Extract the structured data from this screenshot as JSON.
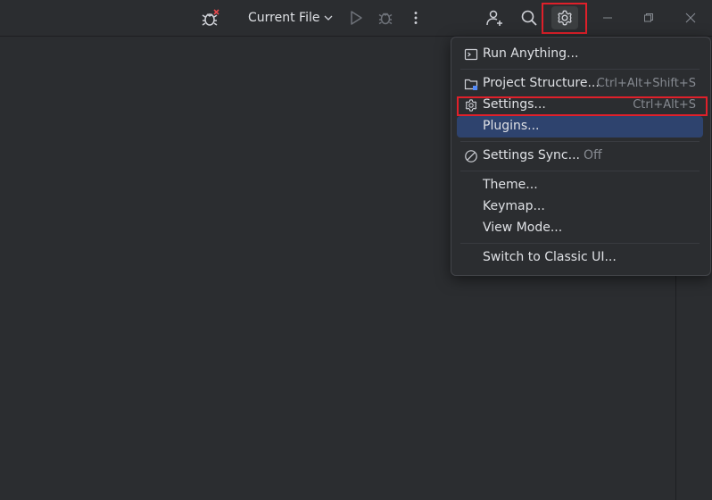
{
  "toolbar": {
    "run_config_label": "Current File",
    "icons": [
      "debug-bug-error-icon",
      "run-icon",
      "debug-icon",
      "more-vertical-icon",
      "add-user-icon",
      "search-icon",
      "settings-gear-icon",
      "minimize-icon",
      "restore-icon",
      "close-icon"
    ]
  },
  "menu": {
    "run_anything": "Run Anything...",
    "project_structure": "Project Structure...",
    "project_structure_shortcut": "Ctrl+Alt+Shift+S",
    "settings": "Settings...",
    "settings_shortcut": "Ctrl+Alt+S",
    "plugins": "Plugins...",
    "settings_sync": "Settings Sync...",
    "settings_sync_state": "Off",
    "theme": "Theme...",
    "keymap": "Keymap...",
    "view_mode": "View Mode...",
    "switch_classic": "Switch to Classic UI..."
  },
  "colors": {
    "background": "#1e1f22",
    "panel": "#2b2d30",
    "selection": "#2e436e",
    "highlight": "#e0202a",
    "error_badge": "#e5484d"
  }
}
